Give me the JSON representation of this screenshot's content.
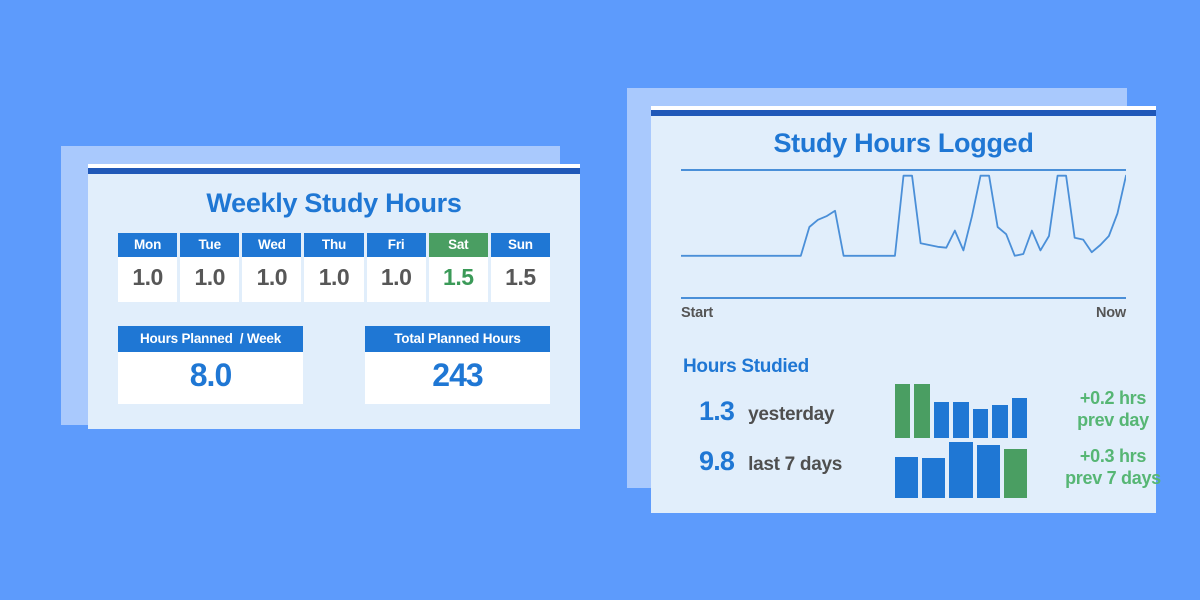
{
  "left_card": {
    "title": "Weekly Study Hours",
    "week": {
      "days": [
        "Mon",
        "Tue",
        "Wed",
        "Thu",
        "Fri",
        "Sat",
        "Sun"
      ],
      "values": [
        "1.0",
        "1.0",
        "1.0",
        "1.0",
        "1.0",
        "1.5",
        "1.5"
      ],
      "highlight_index": 5
    },
    "summary": [
      {
        "label": "Hours Planned  / Week",
        "value": "8.0"
      },
      {
        "label": "Total Planned Hours",
        "value": "243"
      }
    ]
  },
  "right_card": {
    "title": "Study Hours Logged",
    "axis": {
      "start": "Start",
      "end": "Now"
    },
    "section_label": "Hours Studied",
    "stats": [
      {
        "value": "1.3",
        "label": "yesterday",
        "delta": "+0.2 hrs",
        "delta_period": "prev day"
      },
      {
        "value": "9.8",
        "label": "last 7 days",
        "delta": "+0.3 hrs",
        "delta_period": "prev 7 days"
      }
    ]
  },
  "colors": {
    "page_background": "#5d9bfc",
    "card_background": "#e1eefb",
    "shadow_card": "#a9c9fd",
    "card_top_border": "#2058b8",
    "brand_blue": "#1f77d4",
    "accent_green": "#4a9e62",
    "delta_green": "#56b674",
    "value_gray": "#575757",
    "spark_line": "#4a8fd8"
  },
  "chart_data": [
    {
      "type": "line",
      "title": "Study Hours Logged",
      "name": "study-hours-sparkline",
      "xlabel": "",
      "ylabel": "",
      "x_tick_labels": [
        "Start",
        "Now"
      ],
      "grid": false,
      "legend": "none",
      "ylim": [
        0,
        1
      ],
      "values": [
        0.08,
        0.08,
        0.08,
        0.08,
        0.08,
        0.08,
        0.08,
        0.08,
        0.08,
        0.08,
        0.08,
        0.08,
        0.08,
        0.08,
        0.08,
        0.4,
        0.48,
        0.52,
        0.58,
        0.08,
        0.08,
        0.08,
        0.08,
        0.08,
        0.08,
        0.08,
        0.97,
        0.97,
        0.22,
        0.2,
        0.18,
        0.17,
        0.36,
        0.14,
        0.52,
        0.97,
        0.97,
        0.4,
        0.32,
        0.08,
        0.1,
        0.36,
        0.14,
        0.3,
        0.97,
        0.97,
        0.28,
        0.26,
        0.12,
        0.2,
        0.3,
        0.55,
        0.97
      ]
    },
    {
      "type": "bar",
      "name": "yesterday-bars",
      "title": "",
      "categories": [
        "1",
        "2",
        "3",
        "4",
        "5",
        "6",
        "7"
      ],
      "values": [
        1.0,
        1.0,
        0.66,
        0.66,
        0.54,
        0.62,
        0.74
      ],
      "bar_colors": [
        "#4a9e62",
        "#4a9e62",
        "#1f77d4",
        "#1f77d4",
        "#1f77d4",
        "#1f77d4",
        "#1f77d4"
      ],
      "ylim": [
        0,
        1
      ]
    },
    {
      "type": "bar",
      "name": "last-7-days-bars",
      "title": "",
      "categories": [
        "1",
        "2",
        "3",
        "4",
        "5"
      ],
      "values": [
        0.74,
        0.72,
        1.0,
        0.94,
        0.88
      ],
      "bar_colors": [
        "#1f77d4",
        "#1f77d4",
        "#1f77d4",
        "#1f77d4",
        "#4a9e62"
      ],
      "ylim": [
        0,
        1
      ]
    }
  ]
}
